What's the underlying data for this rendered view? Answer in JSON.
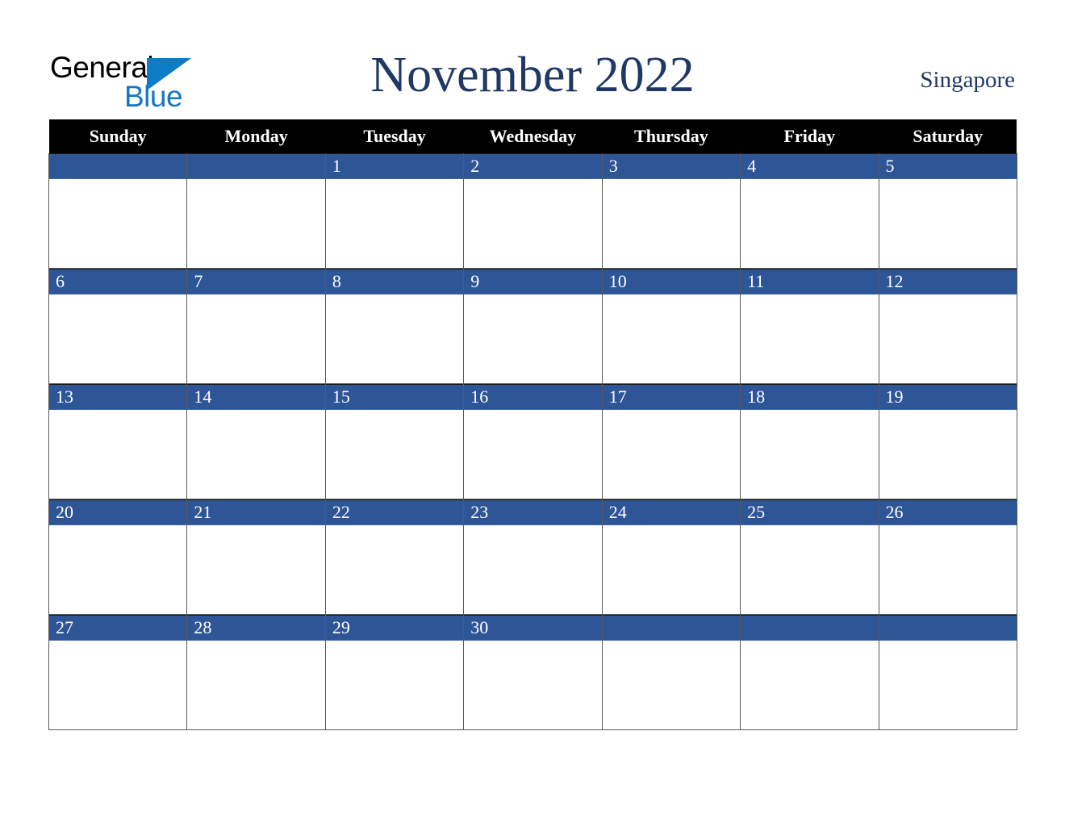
{
  "brand": {
    "name_part1": "General",
    "name_part2": "Blue",
    "triangle_icon": "blue-triangle-icon",
    "colors": {
      "black": "#000000",
      "blue": "#1577c2",
      "triangle_blue": "#0d7cc6"
    }
  },
  "header": {
    "title": "November 2022",
    "location": "Singapore",
    "title_color": "#1f3864"
  },
  "calendar": {
    "month": "November",
    "year": "2022",
    "colors": {
      "header_bg": "#000000",
      "header_text": "#ffffff",
      "date_bar_bg": "#2e5596",
      "date_text": "#ffffff",
      "grid_border": "#595959",
      "cell_bg": "#ffffff"
    },
    "weekday_headers": [
      "Sunday",
      "Monday",
      "Tuesday",
      "Wednesday",
      "Thursday",
      "Friday",
      "Saturday"
    ],
    "weeks": [
      [
        {
          "day": ""
        },
        {
          "day": ""
        },
        {
          "day": "1"
        },
        {
          "day": "2"
        },
        {
          "day": "3"
        },
        {
          "day": "4"
        },
        {
          "day": "5"
        }
      ],
      [
        {
          "day": "6"
        },
        {
          "day": "7"
        },
        {
          "day": "8"
        },
        {
          "day": "9"
        },
        {
          "day": "10"
        },
        {
          "day": "11"
        },
        {
          "day": "12"
        }
      ],
      [
        {
          "day": "13"
        },
        {
          "day": "14"
        },
        {
          "day": "15"
        },
        {
          "day": "16"
        },
        {
          "day": "17"
        },
        {
          "day": "18"
        },
        {
          "day": "19"
        }
      ],
      [
        {
          "day": "20"
        },
        {
          "day": "21"
        },
        {
          "day": "22"
        },
        {
          "day": "23"
        },
        {
          "day": "24"
        },
        {
          "day": "25"
        },
        {
          "day": "26"
        }
      ],
      [
        {
          "day": "27"
        },
        {
          "day": "28"
        },
        {
          "day": "29"
        },
        {
          "day": "30"
        },
        {
          "day": ""
        },
        {
          "day": ""
        },
        {
          "day": ""
        }
      ]
    ]
  }
}
